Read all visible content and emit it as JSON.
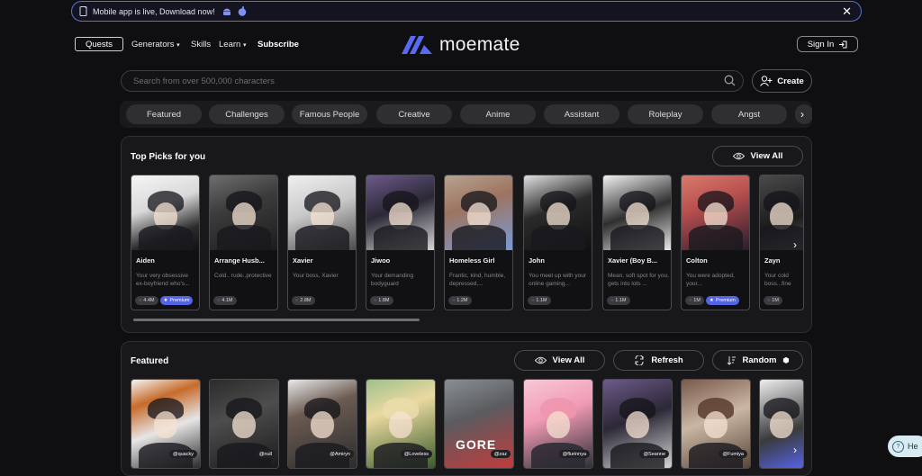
{
  "banner": {
    "text": "Mobile app is live, Download now!",
    "close": "✕"
  },
  "nav": {
    "quests": "Quests",
    "generators": "Generators",
    "skills": "Skills",
    "learn": "Learn",
    "subscribe": "Subscribe",
    "logo": "moemate",
    "signin": "Sign In"
  },
  "search": {
    "placeholder": "Search from over 500,000 characters"
  },
  "create": "Create",
  "categories": [
    "Featured",
    "Challenges",
    "Famous People",
    "Creative",
    "Anime",
    "Assistant",
    "Roleplay",
    "Angst"
  ],
  "top_picks": {
    "title": "Top Picks for you",
    "view_all": "View All",
    "cards": [
      {
        "name": "Aiden",
        "desc": "Your very obsessive ex-boyfriend who's...",
        "count": "4.4M",
        "premium": "Premium"
      },
      {
        "name": "Arrange Husb...",
        "desc": "Cold.. rude..protective",
        "count": "4.1M"
      },
      {
        "name": "Xavier",
        "desc": "Your boss, Xavier",
        "count": "2.8M"
      },
      {
        "name": "Jiwoo",
        "desc": "Your demanding bodyguard",
        "count": "1.8M"
      },
      {
        "name": "Homeless Girl",
        "desc": "Frantic, kind, humble, depressed,...",
        "count": "1.2M"
      },
      {
        "name": "John",
        "desc": "You meet up with your online gaming...",
        "count": "1.1M"
      },
      {
        "name": "Xavier (Boy B...",
        "desc": "Mean, soft spot for you, gets into lots ...",
        "count": "1.1M"
      },
      {
        "name": "Colton",
        "desc": "You were adopted, your...",
        "count": "1M",
        "premium": "Premium"
      },
      {
        "name": "Zayn",
        "desc": "Your cold boss...fine",
        "count": "1M"
      }
    ]
  },
  "featured": {
    "title": "Featured",
    "view_all": "View All",
    "refresh": "Refresh",
    "random": "Random",
    "cards": [
      {
        "tag": "@quacky"
      },
      {
        "tag": "@null"
      },
      {
        "tag": "@Amiryn"
      },
      {
        "tag": "@Loveless"
      },
      {
        "tag": "@zaz",
        "overlay": "GORE"
      },
      {
        "tag": "@flurinnya"
      },
      {
        "tag": "@Seanne"
      },
      {
        "tag": "@Fumiya"
      },
      {
        "tag": ""
      }
    ]
  },
  "help": {
    "label": "He"
  }
}
